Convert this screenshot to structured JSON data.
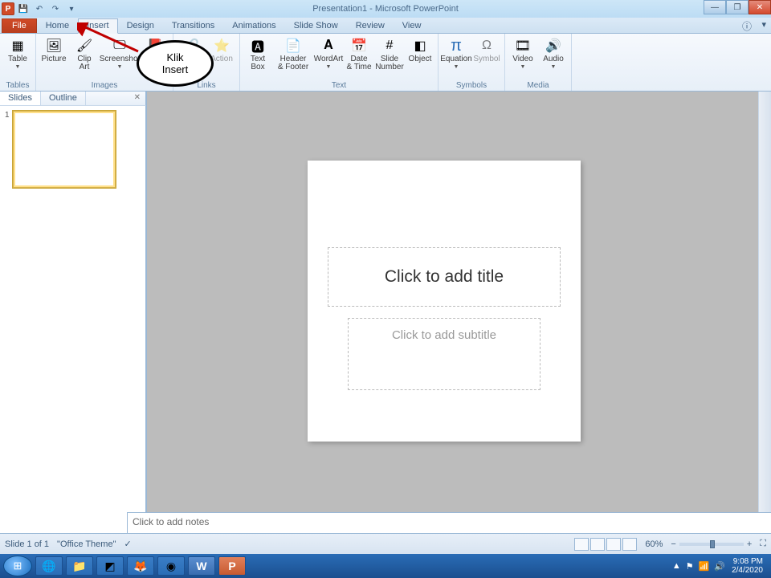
{
  "titlebar": {
    "app_letter": "P",
    "title": "Presentation1 - Microsoft PowerPoint"
  },
  "tabs": {
    "file": "File",
    "home": "Home",
    "insert": "Insert",
    "design": "Design",
    "transitions": "Transitions",
    "animations": "Animations",
    "slideshow": "Slide Show",
    "review": "Review",
    "view": "View"
  },
  "ribbon": {
    "tables": {
      "label": "Tables",
      "table": "Table"
    },
    "images": {
      "label": "Images",
      "picture": "Picture",
      "clipart": "Clip\nArt",
      "screenshot": "Screenshot",
      "photoalbum": "Photo\nAlbum"
    },
    "links": {
      "label": "Links",
      "hyperlink": "Hyperlink",
      "action": "Action"
    },
    "text": {
      "label": "Text",
      "textbox": "Text\nBox",
      "headerfooter": "Header\n& Footer",
      "wordart": "WordArt",
      "datetime": "Date\n& Time",
      "slidenumber": "Slide\nNumber",
      "object": "Object"
    },
    "symbols": {
      "label": "Symbols",
      "equation": "Equation",
      "symbol": "Symbol"
    },
    "media": {
      "label": "Media",
      "video": "Video",
      "audio": "Audio"
    }
  },
  "left": {
    "slides": "Slides",
    "outline": "Outline",
    "thumb_num": "1"
  },
  "slide": {
    "title_ph": "Click to add title",
    "subtitle_ph": "Click to add subtitle"
  },
  "notes": {
    "placeholder": "Click to add notes"
  },
  "status": {
    "slide": "Slide 1 of 1",
    "theme": "\"Office Theme\"",
    "zoom": "60%"
  },
  "tray": {
    "time": "9:08 PM",
    "date": "2/4/2020"
  },
  "annotation": {
    "line1": "Klik",
    "line2": "Insert"
  }
}
